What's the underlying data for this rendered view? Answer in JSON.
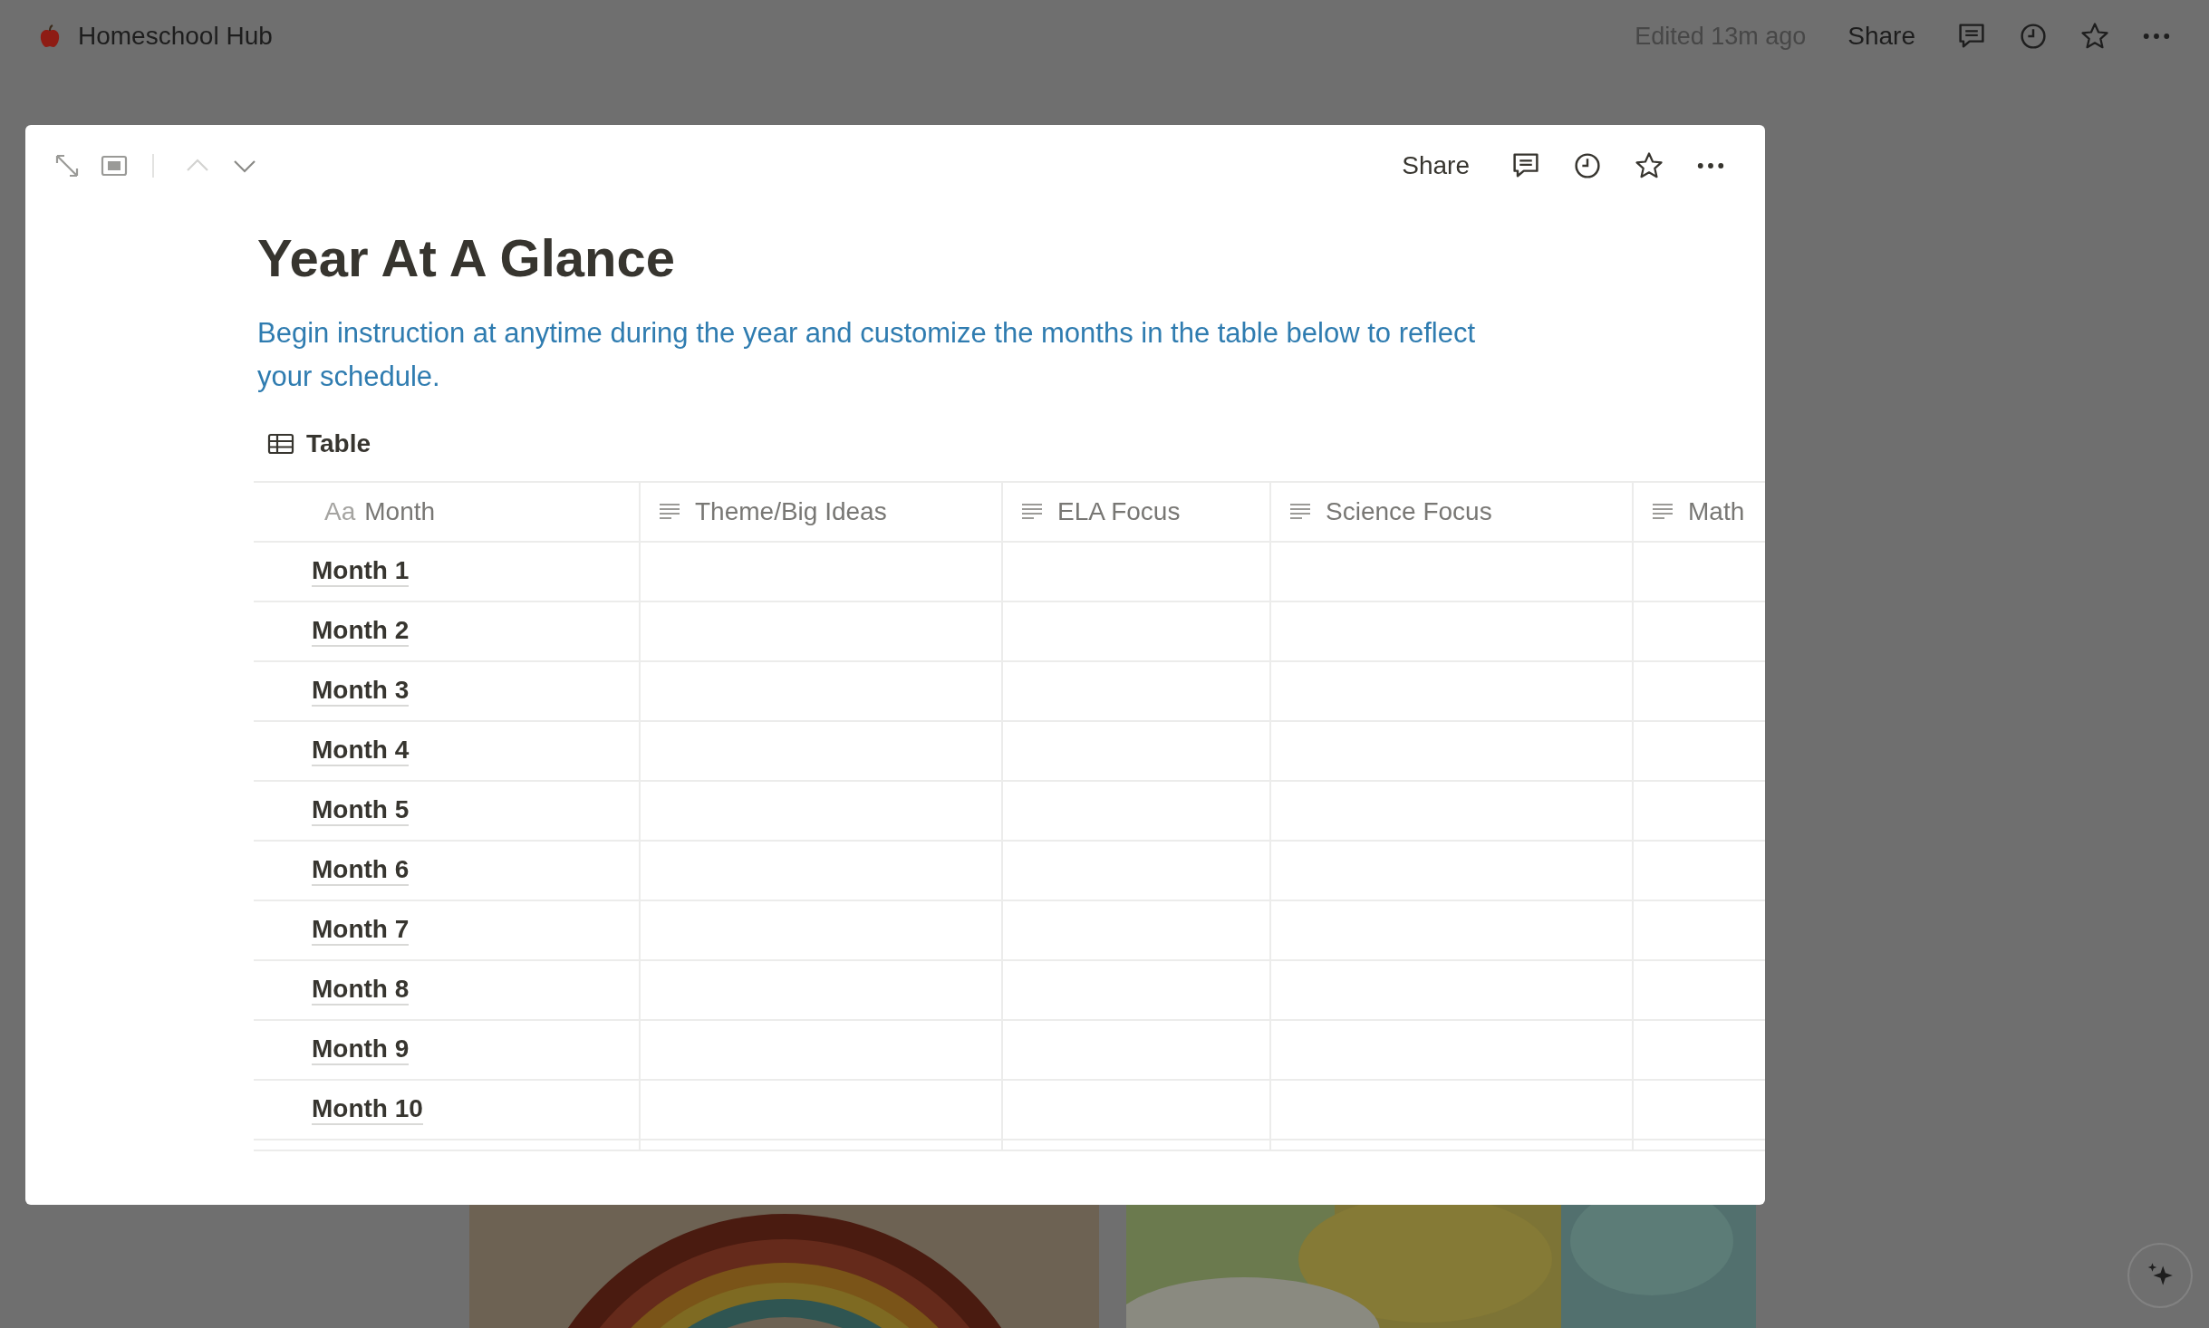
{
  "workspace": {
    "page_title": "Homeschool Hub",
    "edited": "Edited 13m ago",
    "share": "Share"
  },
  "peek": {
    "share": "Share",
    "title": "Year At A Glance",
    "description": "Begin instruction at anytime during the year and customize the months in the table below to reflect your schedule.",
    "view": {
      "label": "Table"
    },
    "table": {
      "columns": [
        {
          "label": "Month",
          "kind": "title",
          "icon_text": "Aa"
        },
        {
          "label": "Theme/Big Ideas",
          "kind": "text"
        },
        {
          "label": "ELA Focus",
          "kind": "text"
        },
        {
          "label": "Science Focus",
          "kind": "text"
        },
        {
          "label": "Math",
          "kind": "text"
        }
      ],
      "rows": [
        {
          "name": "Month 1"
        },
        {
          "name": "Month 2"
        },
        {
          "name": "Month 3"
        },
        {
          "name": "Month 4"
        },
        {
          "name": "Month 5"
        },
        {
          "name": "Month 6"
        },
        {
          "name": "Month 7"
        },
        {
          "name": "Month 8"
        },
        {
          "name": "Month 9"
        },
        {
          "name": "Month 10"
        }
      ]
    }
  }
}
